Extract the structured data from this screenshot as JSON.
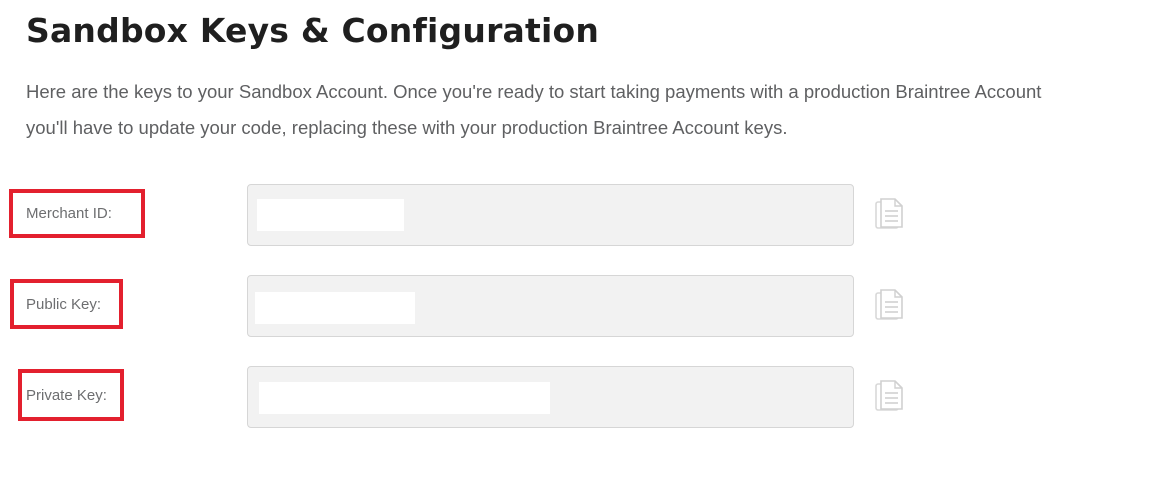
{
  "header": {
    "title": "Sandbox Keys & Configuration"
  },
  "intro": {
    "line1": "Here are the keys to your Sandbox Account. Once you're ready to start taking payments with a production Braintree Account",
    "line2": "you'll have to update your code, replacing these with your production Braintree Account keys."
  },
  "keys": [
    {
      "label": "Merchant ID:",
      "value": "",
      "copy_icon": "copy-icon"
    },
    {
      "label": "Public Key:",
      "value": "",
      "copy_icon": "copy-icon"
    },
    {
      "label": "Private Key:",
      "value": "",
      "copy_icon": "copy-icon"
    }
  ],
  "colors": {
    "highlight": "#e3202e",
    "field_background": "#f2f2f2",
    "field_border": "#d6d6d6",
    "text_muted": "#6d6e70"
  }
}
